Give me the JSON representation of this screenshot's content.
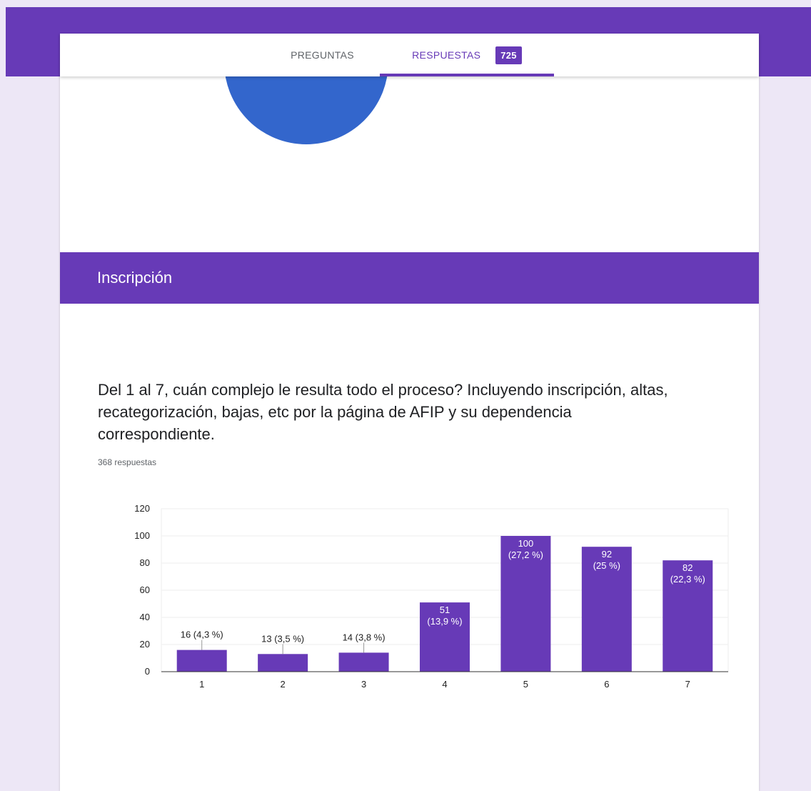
{
  "tabs": {
    "questions_label": "PREGUNTAS",
    "responses_label": "RESPUESTAS",
    "responses_count": "725"
  },
  "previous_chart": {
    "slice_label": "",
    "color": "#3366cc"
  },
  "section": {
    "title": "Inscripción"
  },
  "question": {
    "text": "Del 1 al 7, cuán complejo le resulta todo el proceso? Incluyendo inscripción, altas, recategorización, bajas, etc por la página de AFIP y su dependencia correspondiente.",
    "responses_text": "368 respuestas"
  },
  "colors": {
    "accent": "#673ab7",
    "background": "#ede7f6"
  },
  "chart_data": {
    "type": "bar",
    "categories": [
      "1",
      "2",
      "3",
      "4",
      "5",
      "6",
      "7"
    ],
    "values": [
      16,
      13,
      14,
      51,
      100,
      92,
      82
    ],
    "percent_labels": [
      "(4,3 %)",
      "(3,5 %)",
      "(3,8 %)",
      "(13,9 %)",
      "(27,2 %)",
      "(25 %)",
      "(22,3 %)"
    ],
    "ylim": [
      0,
      120
    ],
    "yticks": [
      0,
      20,
      40,
      60,
      80,
      100,
      120
    ],
    "grid": true,
    "bar_color": "#673ab7",
    "title": "",
    "xlabel": "",
    "ylabel": ""
  }
}
